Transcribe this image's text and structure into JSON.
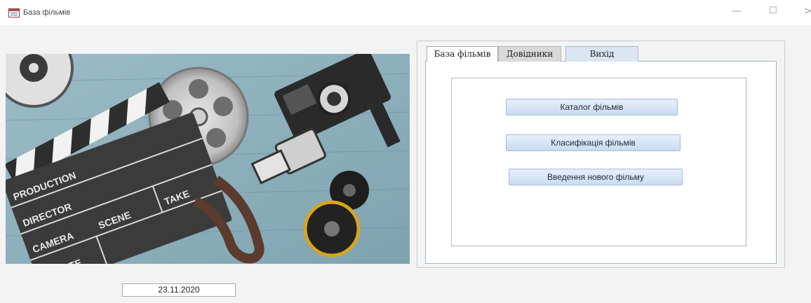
{
  "window": {
    "title": "База фільмів",
    "controls": {
      "minimize": "—",
      "maximize": "☐",
      "next": ">"
    }
  },
  "tabs": [
    {
      "label": "База фільмів",
      "active": true
    },
    {
      "label": "Довідники",
      "active": false
    },
    {
      "label": "Вихід",
      "active": false
    }
  ],
  "buttons": {
    "catalog": "Каталог фільмів",
    "classification": "Класифікація фільмів",
    "add_film": "Введення нового фільму"
  },
  "date_field": {
    "value": "23.11.2020"
  },
  "photo": {
    "clapper_words": [
      "PRODUCTION",
      "DIRECTOR",
      "CAMERA",
      "SCENE",
      "TAKE",
      "DATE"
    ],
    "colors": {
      "background": "#88aab6",
      "clapper": "#3b3b3b"
    }
  },
  "colors": {
    "accent": "#c9dbf2",
    "tab_border": "#9fb3cf"
  }
}
